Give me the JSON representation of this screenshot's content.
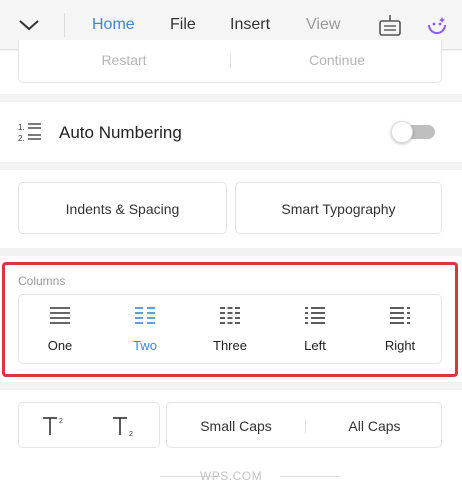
{
  "toolbar": {
    "tabs": [
      {
        "label": "Home"
      },
      {
        "label": "File"
      },
      {
        "label": "Insert"
      },
      {
        "label": "View"
      }
    ],
    "accent": "#3a86e0"
  },
  "list_restart": {
    "restart_label": "Restart",
    "continue_label": "Continue"
  },
  "auto_numbering": {
    "label": "Auto Numbering",
    "enabled": false
  },
  "format_buttons": {
    "indents_label": "Indents & Spacing",
    "typography_label": "Smart Typography"
  },
  "columns": {
    "label": "Columns",
    "options": [
      {
        "label": "One",
        "icon": "one-column-icon"
      },
      {
        "label": "Two",
        "icon": "two-columns-icon",
        "selected": true
      },
      {
        "label": "Three",
        "icon": "three-columns-icon"
      },
      {
        "label": "Left",
        "icon": "left-column-icon"
      },
      {
        "label": "Right",
        "icon": "right-column-icon"
      }
    ],
    "highlight_color": "#d9363e"
  },
  "text_style": {
    "superscript_icon": "superscript-icon",
    "subscript_icon": "subscript-icon",
    "small_caps_label": "Small Caps",
    "all_caps_label": "All Caps"
  },
  "footer": {
    "brand": "WPS.COM"
  }
}
